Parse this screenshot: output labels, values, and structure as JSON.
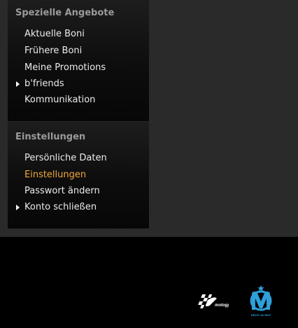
{
  "colors": {
    "page_background": "#000000",
    "content_background": "#2a2a2a",
    "panel_title": "#9a9a9a",
    "menu_text": "#ececec",
    "menu_active": "#f2a83a",
    "om_logo": "#2e9fd8"
  },
  "sidebar": {
    "special_offers": {
      "title": "Spezielle Angebote",
      "items": [
        {
          "label": "Aktuelle Boni"
        },
        {
          "label": "Frühere Boni"
        },
        {
          "label": "Meine Promotions"
        },
        {
          "label": "b'friends",
          "has_submenu": true,
          "icon": "triangle-right-icon"
        },
        {
          "label": "Kommunikation"
        }
      ]
    },
    "settings": {
      "title": "Einstellungen",
      "items": [
        {
          "label": "Persönliche Daten"
        },
        {
          "label": "Einstellungen",
          "active": true
        },
        {
          "label": "Passwort ändern"
        },
        {
          "label": "Konto schließen",
          "has_submenu": true,
          "icon": "triangle-right-icon"
        }
      ]
    }
  },
  "footer": {
    "logos": [
      {
        "name": "motogp-logo",
        "text": "motogp"
      },
      {
        "name": "olympique-de-marseille-logo",
        "text": "DROIT AU BUT"
      }
    ]
  }
}
